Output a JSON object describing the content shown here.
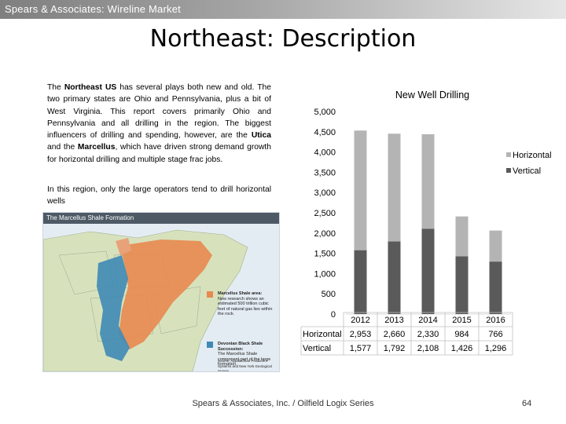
{
  "header": {
    "title": "Spears & Associates:  Wireline Market"
  },
  "slide": {
    "title": "Northeast:  Description"
  },
  "body": {
    "p1_pre": "The ",
    "p1_bold1": "Northeast US",
    "p1_mid1": " has several plays both new and old. The two primary states are Ohio and Pennsylvania, plus a bit of West Virginia.  This report covers primarily Ohio and Pennsylvania and all drilling in the region.  The biggest influencers of drilling and spending, however, are the ",
    "p1_bold2": "Utica",
    "p1_mid2": " and the ",
    "p1_bold3": "Marcellus",
    "p1_post": ", which have driven strong demand growth for horizontal drilling and multiple stage frac jobs.",
    "p2": "In this region, only the large operators tend to drill horizontal wells"
  },
  "map": {
    "title": "The Marcellus Shale Formation",
    "legend1_title": "Marcellus Shale area:",
    "legend1_text": "New research shows an estimated 500 trillion cubic feet of natural gas lies within the rock.",
    "legend2_title": "Devonian Black Shale Succession:",
    "legend2_text": "The Marcellus Shale component part of the large formation.",
    "source": "Source: Appalachian Producers Systems and New York Geological Survey",
    "colors": {
      "marcellus": "#e8894f",
      "devonian": "#3f8ab5",
      "land": "#c9d9a6"
    }
  },
  "chart_data": {
    "type": "bar",
    "stacked": true,
    "title": "New Well Drilling",
    "categories": [
      "2012",
      "2013",
      "2014",
      "2015",
      "2016"
    ],
    "series": [
      {
        "name": "Vertical",
        "values": [
          1577,
          1792,
          2108,
          1426,
          1296
        ],
        "color": "#5a5a5a"
      },
      {
        "name": "Horizontal",
        "values": [
          2953,
          2660,
          2330,
          984,
          766
        ],
        "color": "#b4b4b4"
      }
    ],
    "ylim": [
      0,
      5000
    ],
    "yticks": [
      "5,000",
      "4,500",
      "4,000",
      "3,500",
      "3,000",
      "2,500",
      "2,000",
      "1,500",
      "1,000",
      "500",
      "0"
    ],
    "ytick_values": [
      5000,
      4500,
      4000,
      3500,
      3000,
      2500,
      2000,
      1500,
      1000,
      500,
      0
    ],
    "legend": [
      "Horizontal",
      "Vertical"
    ],
    "legend_position": "right",
    "grid": false,
    "table": {
      "rows": [
        {
          "label": "Horizontal",
          "values": [
            "2,953",
            "2,660",
            "2,330",
            "984",
            "766"
          ]
        },
        {
          "label": "Vertical",
          "values": [
            "1,577",
            "1,792",
            "2,108",
            "1,426",
            "1,296"
          ]
        }
      ]
    }
  },
  "footer": {
    "text": "Spears & Associates, Inc. / Oilfield Logix Series",
    "page": "64"
  }
}
